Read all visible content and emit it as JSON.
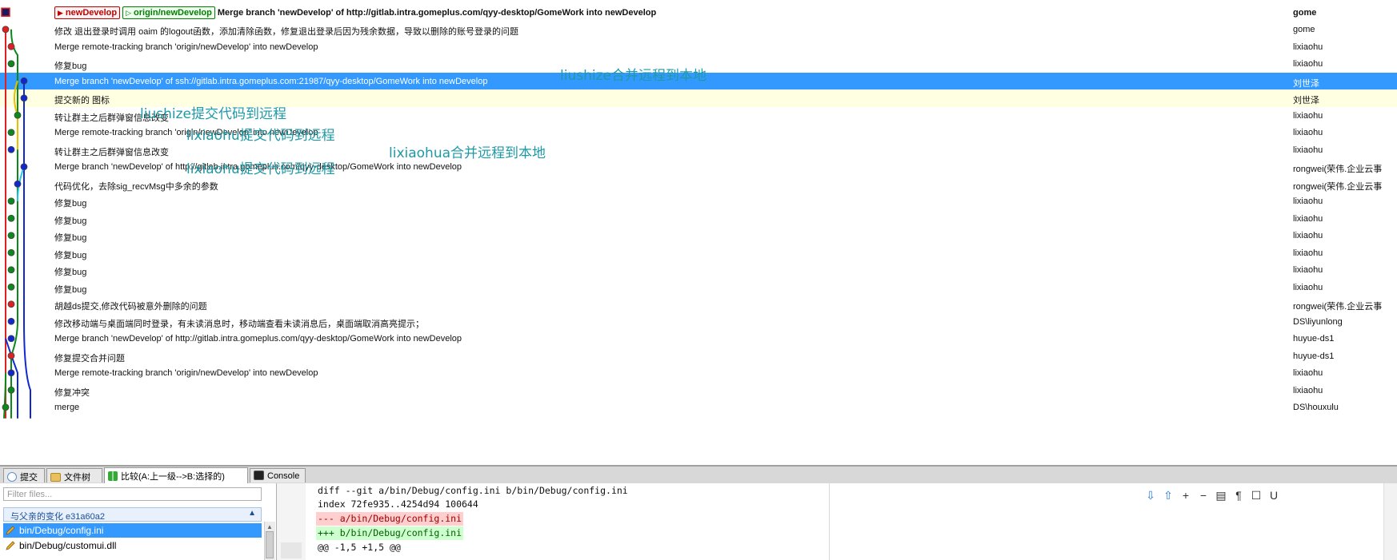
{
  "commits": [
    {
      "refs": [
        {
          "type": "local",
          "label": "newDevelop"
        },
        {
          "type": "remote",
          "label": "origin/newDevelop"
        }
      ],
      "message": "Merge branch 'newDevelop' of http://gitlab.intra.gomeplus.com/qyy-desktop/GomeWork into newDevelop",
      "author": "gome"
    },
    {
      "refs": [],
      "message": "修改 退出登录时调用 oaim 的logout函数，添加清除函数，修复退出登录后因为残余数据，导致以删除的账号登录的问题",
      "author": "gome"
    },
    {
      "refs": [],
      "message": "Merge remote-tracking branch 'origin/newDevelop' into newDevelop",
      "author": "lixiaohu"
    },
    {
      "refs": [],
      "message": "修复bug",
      "author": "lixiaohu"
    },
    {
      "refs": [],
      "message": "Merge branch 'newDevelop' of ssh://gitlab.intra.gomeplus.com:21987/qyy-desktop/GomeWork into newDevelop",
      "author": "刘世泽"
    },
    {
      "refs": [],
      "message": "提交新的 图标",
      "author": "刘世泽"
    },
    {
      "refs": [],
      "message": "转让群主之后群弹窗信息改变",
      "author": "lixiaohu"
    },
    {
      "refs": [],
      "message": "Merge remote-tracking branch 'origin/newDevelop' into newDevelop",
      "author": "lixiaohu"
    },
    {
      "refs": [],
      "message": "转让群主之后群弹窗信息改变",
      "author": "lixiaohu"
    },
    {
      "refs": [],
      "message": "Merge branch 'newDevelop' of http://gitlab.intra.gomeplus.com/qyy-desktop/GomeWork into newDevelop",
      "author": "rongwei(荣伟.企业云事"
    },
    {
      "refs": [],
      "message": "代码优化，去除sig_recvMsg中多余的参数",
      "author": "rongwei(荣伟.企业云事"
    },
    {
      "refs": [],
      "message": "修复bug",
      "author": "lixiaohu"
    },
    {
      "refs": [],
      "message": "修复bug",
      "author": "lixiaohu"
    },
    {
      "refs": [],
      "message": "修复bug",
      "author": "lixiaohu"
    },
    {
      "refs": [],
      "message": "修复bug",
      "author": "lixiaohu"
    },
    {
      "refs": [],
      "message": "修复bug",
      "author": "lixiaohu"
    },
    {
      "refs": [],
      "message": "修复bug",
      "author": "lixiaohu"
    },
    {
      "refs": [],
      "message": "胡越ds提交,修改代码被意外删除的问题",
      "author": "rongwei(荣伟.企业云事"
    },
    {
      "refs": [],
      "message": "修改移动端与桌面端同时登录，有未读消息时，移动端查看未读消息后，桌面端取消高亮提示；",
      "author": "DS\\liyunlong"
    },
    {
      "refs": [],
      "message": "Merge branch 'newDevelop' of http://gitlab.intra.gomeplus.com/qyy-desktop/GomeWork into newDevelop",
      "author": "huyue-ds1"
    },
    {
      "refs": [],
      "message": "修复提交合并问题",
      "author": "huyue-ds1"
    },
    {
      "refs": [],
      "message": "Merge remote-tracking branch 'origin/newDevelop' into newDevelop",
      "author": "lixiaohu"
    },
    {
      "refs": [],
      "message": "修复冲突",
      "author": "lixiaohu"
    },
    {
      "refs": [],
      "message": "merge",
      "author": "DS\\houxulu"
    }
  ],
  "selected_row": 4,
  "highlighted_row": 5,
  "annotations": [
    {
      "text": "liushize合并远程到本地"
    },
    {
      "text": "liushize提交代码到远程"
    },
    {
      "text": "lixiaohu提交代码到远程"
    },
    {
      "text": "lixiaohua合并远程到本地"
    },
    {
      "text": "lixiaohu提交代码到远程"
    }
  ],
  "tabs": [
    {
      "label": "提交",
      "icon": "commit-icon"
    },
    {
      "label": "文件树",
      "icon": "folder-tree-icon"
    },
    {
      "label": "比较(A:上一级-->B:选择的)",
      "icon": "compare-icon"
    },
    {
      "label": "Console",
      "icon": "console-icon"
    }
  ],
  "active_tab": 2,
  "file_filter": {
    "placeholder": "Filter files..."
  },
  "changes_header": "与父亲的变化 e31a60a2",
  "files": [
    {
      "name": "bin/Debug/config.ini",
      "selected": true
    },
    {
      "name": "bin/Debug/customui.dll",
      "selected": false
    }
  ],
  "diff_lines": [
    {
      "text": "diff --git a/bin/Debug/config.ini b/bin/Debug/config.ini",
      "kind": "meta"
    },
    {
      "text": "index 72fe935..4254d94 100644",
      "kind": "meta"
    },
    {
      "text": "--- a/bin/Debug/config.ini",
      "kind": "del"
    },
    {
      "text": "+++ b/bin/Debug/config.ini",
      "kind": "add"
    },
    {
      "text": "@@ -1,5 +1,5 @@",
      "kind": "meta"
    }
  ],
  "toolbar": {
    "wrap_label": "U"
  },
  "graph_colors": {
    "red": "#e02020",
    "blue": "#1028d0",
    "green": "#0a8a1a",
    "cyan": "#28c8e0",
    "yellow": "#e8c000"
  }
}
